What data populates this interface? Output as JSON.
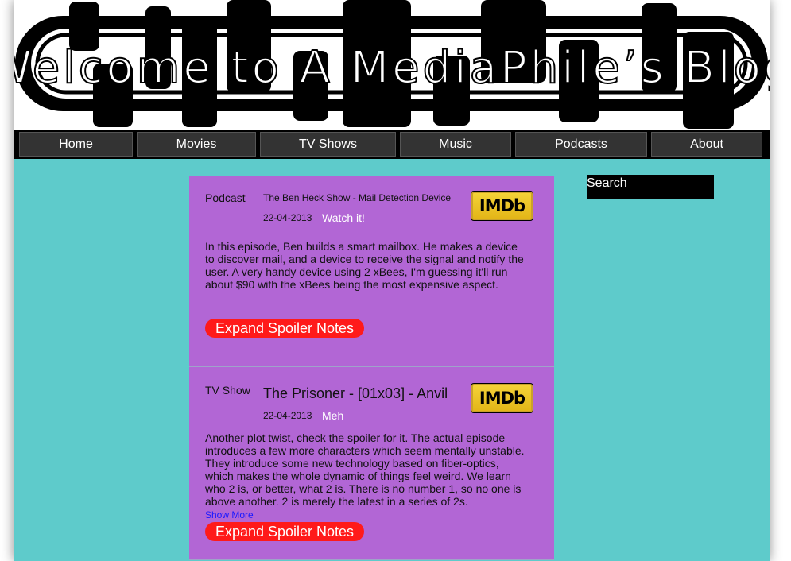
{
  "header": {
    "title": "Welcome to A MediaPhile’s Blog"
  },
  "nav": {
    "items": [
      "Home",
      "Movies",
      "TV Shows",
      "Music",
      "Podcasts",
      "About"
    ]
  },
  "search": {
    "placeholder": "Search"
  },
  "posts": [
    {
      "type": "Podcast",
      "title": "The Ben Heck Show - Mail Detection Device",
      "date": "22-04-2013",
      "rating": "Watch it!",
      "imdb_label": "IMDb",
      "body": "In this episode, Ben builds a smart mailbox. He makes a device to discover mail, and a device to receive the signal and notify the user. A very handy device using 2 xBees, I'm guessing it'll run about $90 with the xBees being the most expensive aspect.",
      "spoiler_label": "Expand Spoiler Notes"
    },
    {
      "type": "TV Show",
      "title": "The Prisoner - [01x03] - Anvil",
      "date": "22-04-2013",
      "rating": "Meh",
      "imdb_label": "IMDb",
      "body": "Another plot twist, check the spoiler for it. The actual episode introduces a few more characters which seem mentally unstable. They introduce some new technology based on fiber-optics, which makes the whole dynamic of things feel weird. We learn who 2 is, or better, what 2 is. There is no number 1, so no one is above another. 2 is merely the latest in a series of 2s.",
      "show_more": "Show More",
      "spoiler_label": "Expand Spoiler Notes"
    }
  ],
  "colors": {
    "background": "#5ecbcb",
    "post_background": "#b266d5",
    "spoiler_button": "#ff1a1a",
    "imdb": "#f5d43a"
  }
}
